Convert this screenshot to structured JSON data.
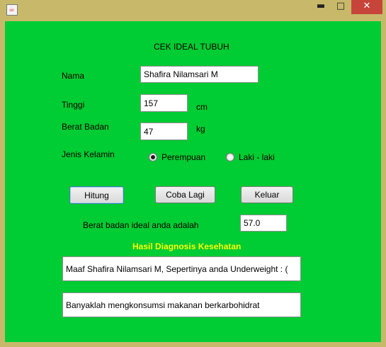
{
  "window": {
    "minimize_glyph": "▬",
    "maximize_glyph": "□",
    "close_glyph": "✕",
    "app_icon_glyph": "☕"
  },
  "form": {
    "title": "CEK IDEAL TUBUH",
    "nama_label": "Nama",
    "nama_value": "Shafira Nilamsari M",
    "tinggi_label": "Tinggi",
    "tinggi_value": "157",
    "tinggi_unit": "cm",
    "berat_label": "Berat Badan",
    "berat_value": "47",
    "berat_unit": "kg",
    "jenis_label": "Jenis Kelamin",
    "radio_perempuan": "Perempuan",
    "radio_laki": "Laki - laki",
    "selected_gender": "Perempuan"
  },
  "buttons": {
    "hitung": "Hitung",
    "coba_lagi": "Coba Lagi",
    "keluar": "Keluar"
  },
  "result": {
    "ideal_label": "Berat badan ideal anda adalah",
    "ideal_value": "57.0",
    "diagnosis_title": "Hasil Diagnosis Kesehatan",
    "diagnosis_line1": "Maaf Shafira Nilamsari M, Sepertinya anda Underweight : (",
    "diagnosis_line2": "Banyaklah mengkonsumsi makanan berkarbohidrat"
  },
  "colors": {
    "panel": "#00cc33",
    "frame": "#c8b96a",
    "diagnosis_title": "#ffff00"
  }
}
